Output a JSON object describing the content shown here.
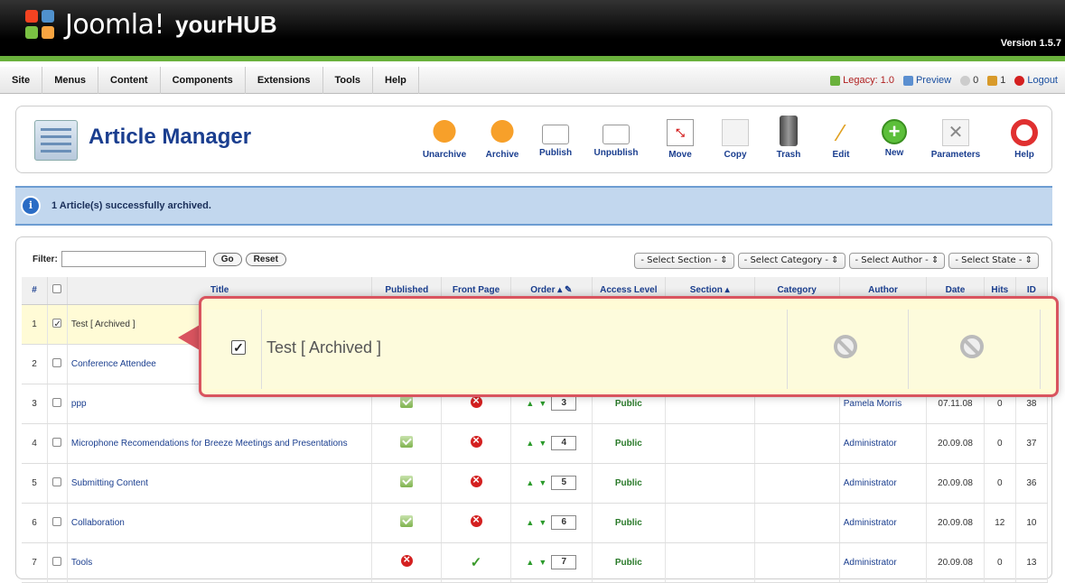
{
  "header": {
    "brand": "Joomla!",
    "site": "yourHUB",
    "version": "Version 1.5.7"
  },
  "menu": [
    "Site",
    "Menus",
    "Content",
    "Components",
    "Extensions",
    "Tools",
    "Help"
  ],
  "status": {
    "legacy": "Legacy: 1.0",
    "preview": "Preview",
    "messages": "0",
    "users": "1",
    "logout": "Logout"
  },
  "page": {
    "title": "Article Manager"
  },
  "toolbar": [
    {
      "label": "Unarchive",
      "icon": "unarchive-icon"
    },
    {
      "label": "Archive",
      "icon": "archive-icon"
    },
    {
      "label": "Publish",
      "icon": "publish-icon"
    },
    {
      "label": "Unpublish",
      "icon": "unpublish-icon"
    },
    {
      "label": "Move",
      "icon": "move-icon"
    },
    {
      "label": "Copy",
      "icon": "copy-icon"
    },
    {
      "label": "Trash",
      "icon": "trash-icon"
    },
    {
      "label": "Edit",
      "icon": "edit-icon"
    },
    {
      "label": "New",
      "icon": "new-icon"
    },
    {
      "label": "Parameters",
      "icon": "parameters-icon"
    },
    {
      "label": "Help",
      "icon": "help-icon"
    }
  ],
  "message": "1 Article(s) successfully archived.",
  "filter": {
    "label": "Filter:",
    "go": "Go",
    "reset": "Reset"
  },
  "selects": [
    "- Select Section -",
    "- Select Category -",
    "- Select Author -",
    "- Select State -"
  ],
  "columns": [
    "#",
    "",
    "Title",
    "Published",
    "Front Page",
    "Order",
    "Access Level",
    "Section",
    "Category",
    "Author",
    "Date",
    "Hits",
    "ID"
  ],
  "rows": [
    {
      "num": "1",
      "title": "Test [ Archived ]",
      "checked": true,
      "published": "",
      "front": "",
      "order": "",
      "access": "",
      "author": "",
      "date": "",
      "hits": "",
      "id": ""
    },
    {
      "num": "2",
      "title": "Conference Attendee",
      "checked": false,
      "published": "",
      "front": "",
      "order": "",
      "access": "",
      "author": "",
      "date": "",
      "hits": "",
      "id": ""
    },
    {
      "num": "3",
      "title": "ppp",
      "checked": false,
      "published": "ok",
      "front": "no",
      "order": "3",
      "access": "Public",
      "author": "Pamela Morris",
      "date": "07.11.08",
      "hits": "0",
      "id": "38"
    },
    {
      "num": "4",
      "title": "Microphone Recomendations for Breeze Meetings and Presentations",
      "checked": false,
      "published": "ok",
      "front": "no",
      "order": "4",
      "access": "Public",
      "author": "Administrator",
      "date": "20.09.08",
      "hits": "0",
      "id": "37"
    },
    {
      "num": "5",
      "title": "Submitting Content",
      "checked": false,
      "published": "ok",
      "front": "no",
      "order": "5",
      "access": "Public",
      "author": "Administrator",
      "date": "20.09.08",
      "hits": "0",
      "id": "36"
    },
    {
      "num": "6",
      "title": "Collaboration",
      "checked": false,
      "published": "ok",
      "front": "no",
      "order": "6",
      "access": "Public",
      "author": "Administrator",
      "date": "20.09.08",
      "hits": "12",
      "id": "10"
    },
    {
      "num": "7",
      "title": "Tools",
      "checked": false,
      "published": "no",
      "front": "check",
      "order": "7",
      "access": "Public",
      "author": "Administrator",
      "date": "20.09.08",
      "hits": "0",
      "id": "13"
    }
  ],
  "popup": {
    "title": "Test [ Archived ]"
  },
  "colors": {
    "accent": "#1a3e8f",
    "green": "#6ab13c",
    "highlight": "#d9545f",
    "message_bg": "#c2d7ee"
  }
}
